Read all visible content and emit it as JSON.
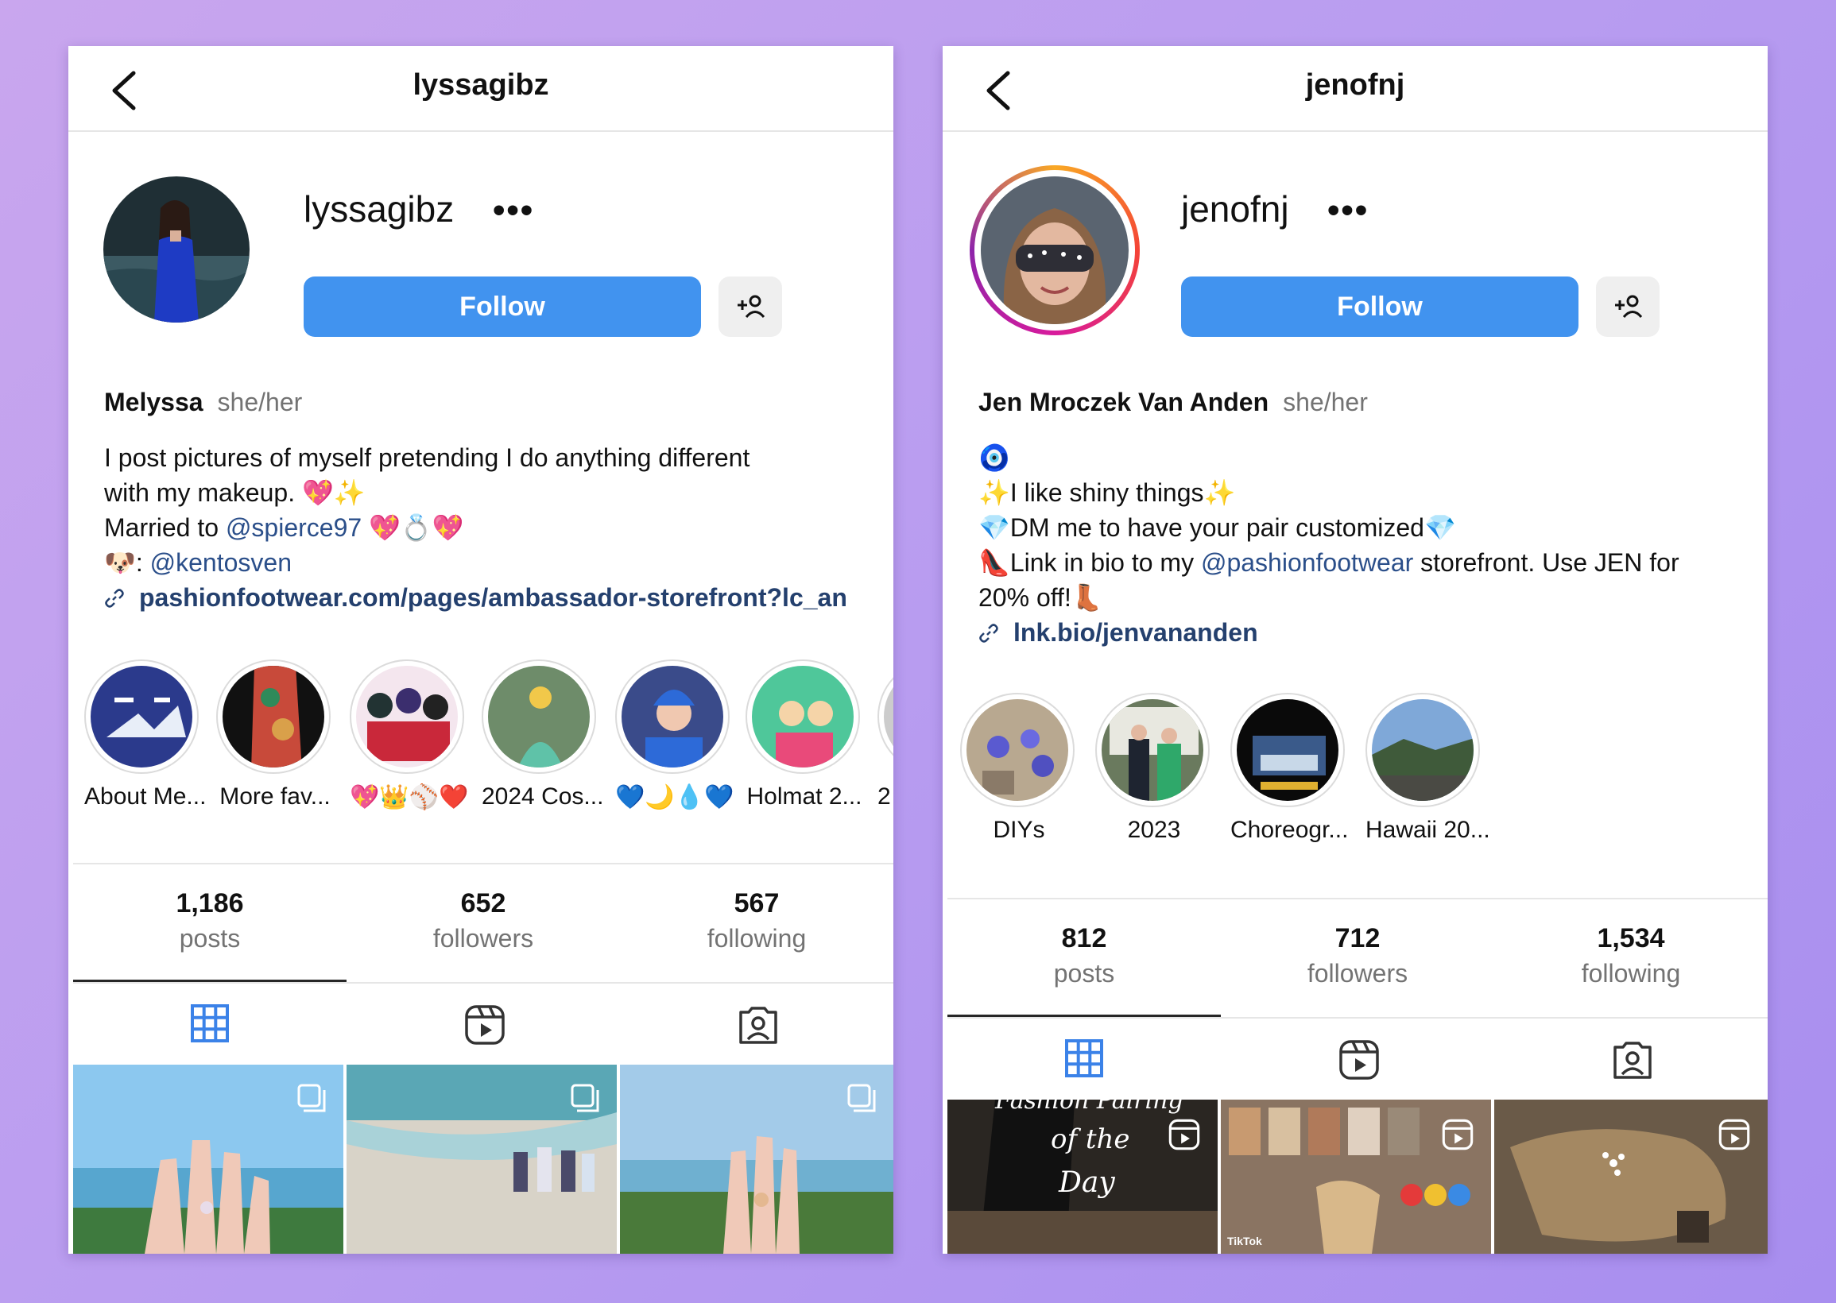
{
  "colors": {
    "follow_blue": "#4193ef",
    "mention": "#2b4f8a",
    "muted": "#737373",
    "background": "#b99cf0"
  },
  "profiles": [
    {
      "topbar_title": "lyssagibz",
      "username": "lyssagibz",
      "more_label": "•••",
      "follow_label": "Follow",
      "display_name": "Melyssa",
      "pronouns": "she/her",
      "bio": {
        "line1": "I post pictures of myself pretending I do anything different",
        "line2": "with my makeup. 💖✨",
        "line3_pre": "Married to ",
        "line3_mention": "@spierce97",
        "line3_post": " 💖💍💖",
        "line4_pre": "🐶: ",
        "line4_mention": "@kentosven",
        "link": "pashionfootwear.com/pages/ambassador-storefront?lc_an"
      },
      "highlights": [
        "About Me...",
        "More fav...",
        "💖👑⚾❤️",
        "2024 Cos...",
        "💙🌙💧💙",
        "Holmat 2...",
        "2"
      ],
      "stats": {
        "posts": "1,186",
        "posts_label": "posts",
        "followers": "652",
        "followers_label": "followers",
        "following": "567",
        "following_label": "following"
      }
    },
    {
      "topbar_title": "jenofnj",
      "username": "jenofnj",
      "more_label": "•••",
      "follow_label": "Follow",
      "display_name": "Jen Mroczek Van Anden",
      "pronouns": "she/her",
      "bio": {
        "line1": "🧿",
        "line2": "✨I like shiny things✨",
        "line3": "💎DM me to have your pair customized💎",
        "line4_pre": "👠Link in bio to my ",
        "line4_mention": "@pashionfootwear",
        "line4_post": " storefront. Use JEN for",
        "line5": "20% off!👢",
        "link": "lnk.bio/jenvananden"
      },
      "highlights": [
        "DIYs",
        "2023",
        "Choreogr...",
        "Hawaii 20..."
      ],
      "stats": {
        "posts": "812",
        "posts_label": "posts",
        "followers": "712",
        "followers_label": "followers",
        "following": "1,534",
        "following_label": "following"
      },
      "thumb_texts": {
        "fashion": "Fashion Pairing",
        "of_the": "of the",
        "day": "Day",
        "tiktok": "TikTok"
      }
    }
  ]
}
